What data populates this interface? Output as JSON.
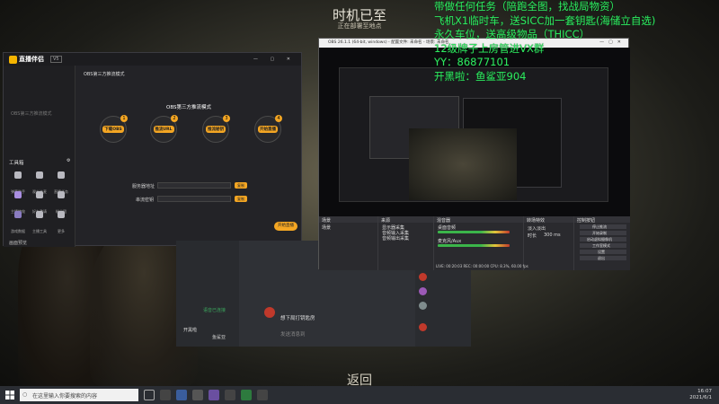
{
  "game": {
    "title": "时机已至",
    "subtitle": "正在部署至地点",
    "back_label": "返回"
  },
  "overlay_lines": [
    "带做任何任务（陪跑全图，找战局物资）",
    "飞机X1临时车，送SICC加一套钥匙(海储立自选)",
    "永久车位，送高级物品（THICC）",
    "12级牌子上房管进VX群",
    "YY：86877101",
    "开黑啦：鱼鲨亚904"
  ],
  "live_window": {
    "app_name": "直播伴侣",
    "version": "V5",
    "sidebar_note": "OBS第三方推流模式",
    "tools_title": "工具箱",
    "tools": [
      "弹幕助手",
      "观众连麦",
      "直播任务",
      "主播特效",
      "好友邀请",
      "粉丝团",
      "游戏数据",
      "主播工具",
      "更多"
    ],
    "mode_title": "OBS第三方推流模式",
    "steps": [
      "下载OBS",
      "推流URL",
      "推流秘钥",
      "开始直播"
    ],
    "server_label": "服务器地址",
    "key_label": "串流密钥",
    "copy_label": "复制",
    "go_live_label": "开始直播",
    "bottom_note": "画面预览"
  },
  "chat_window": {
    "connected_label": "语音已连接",
    "channel_label": "开黑啦",
    "user_label": "鱼鲨亚",
    "message": "想下局打钥匙房",
    "input_placeholder": "发送消息到"
  },
  "obs": {
    "title": "OBS 26.1.1 (64-bit, windows) - 配置文件: 未命名 - 场景: 未命名",
    "docks": [
      "场景",
      "来源",
      "混音器",
      "转场特效",
      "控制按钮"
    ],
    "scene_item": "场景",
    "sources": [
      "显示器采集",
      "音频输入采集",
      "音频输出采集"
    ],
    "mixer": [
      "桌面音频",
      "麦克风/Aux"
    ],
    "transition": "淡入淡出",
    "duration_label": "时长",
    "duration_value": "300 ms",
    "controls": [
      "停止推流",
      "开始录制",
      "启动虚拟摄像机",
      "工作室模式",
      "设置",
      "退出"
    ],
    "status": "LIVE: 00:20:03   REC: 00:00:00   CPU: 8.3%, 60.00 fps"
  },
  "taskbar": {
    "search_placeholder": "在这里输入你要搜索的内容",
    "time": "16:07",
    "date": "2021/6/1"
  },
  "colors": {
    "overlay_text": "#2ee860",
    "accent": "#f4a623",
    "obs_dark": "#202024"
  }
}
